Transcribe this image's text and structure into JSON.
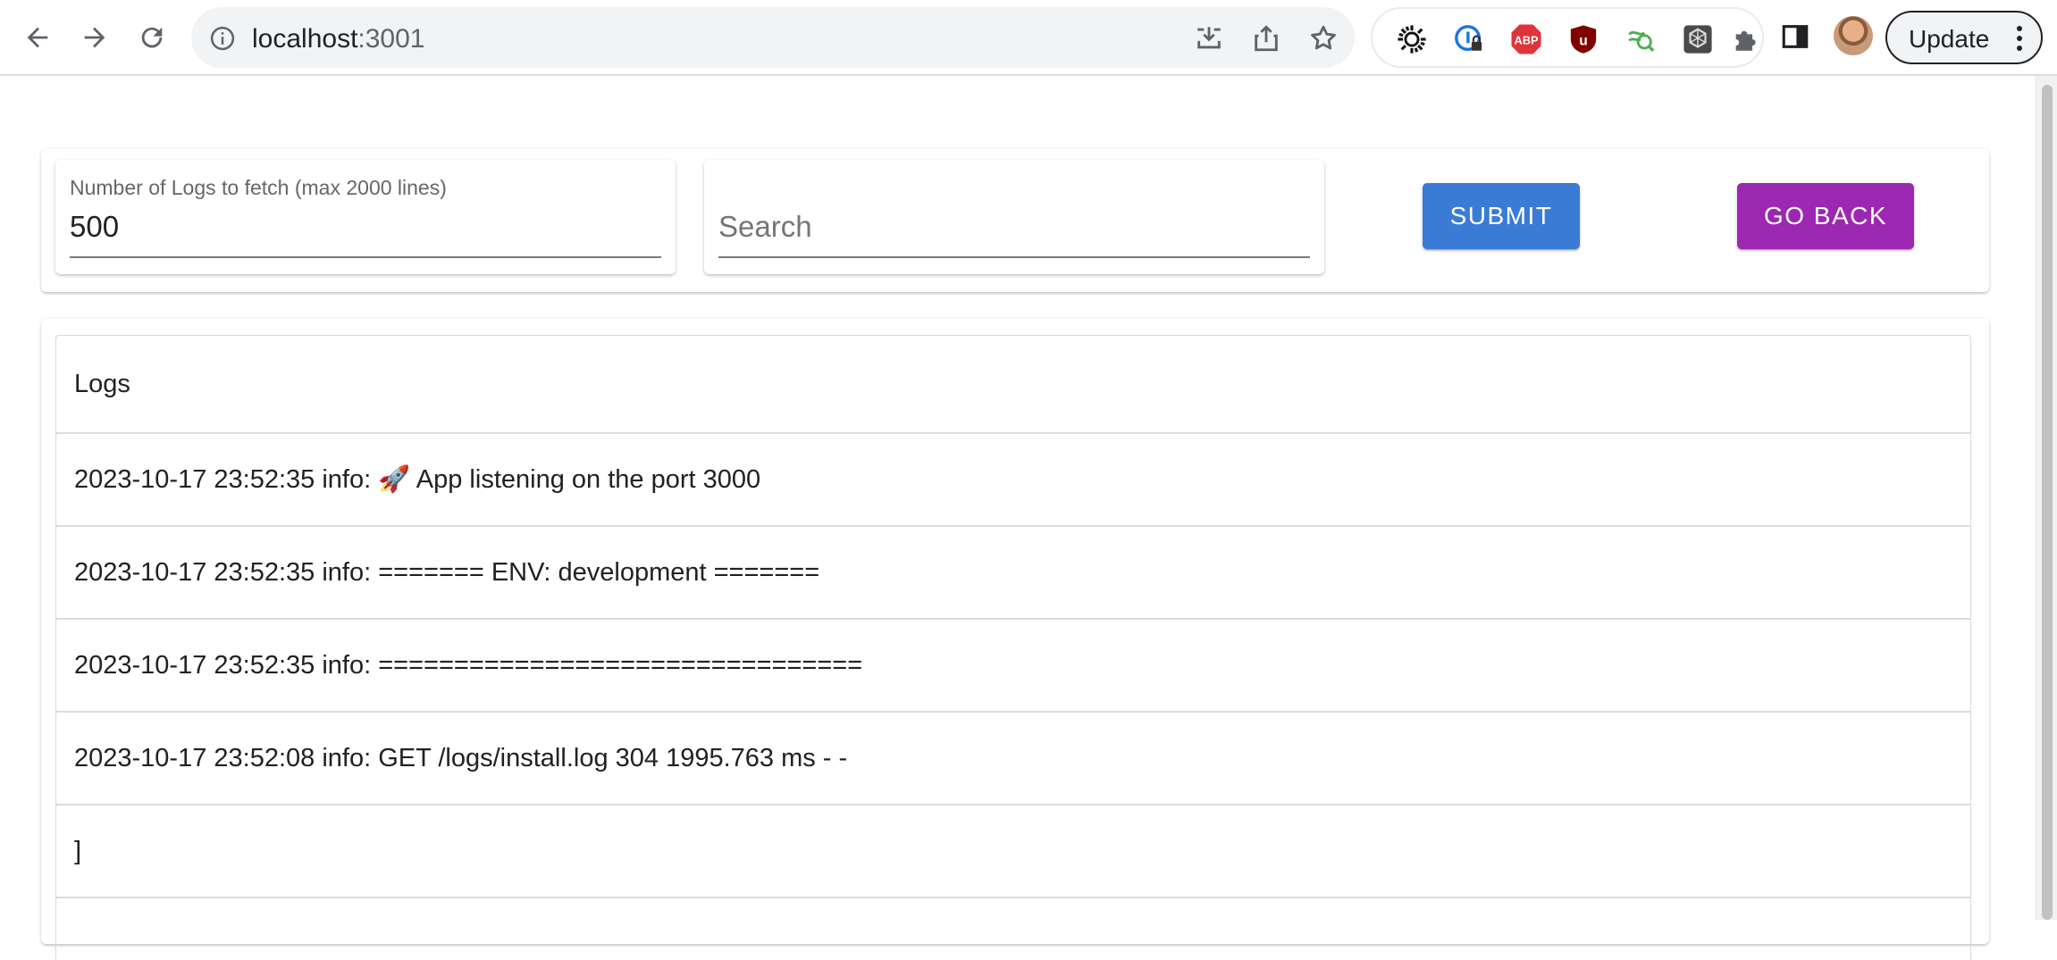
{
  "browser": {
    "url_host": "localhost",
    "url_port": ":3001",
    "update_label": "Update",
    "extensions": [
      "sun-extension-icon",
      "password-manager-icon",
      "adblock-plus-icon",
      "ublock-origin-icon",
      "search-extension-icon",
      "openai-extension-icon",
      "puzzle-piece-icon"
    ]
  },
  "controls": {
    "log_count_label": "Number of Logs to fetch (max 2000 lines)",
    "log_count_value": "500",
    "search_placeholder": "Search",
    "submit_label": "SUBMIT",
    "go_back_label": "GO BACK"
  },
  "logs": {
    "header": "Logs",
    "rows": [
      "2023-10-17 23:52:35 info: 🚀 App listening on the port 3000",
      "2023-10-17 23:52:35 info: ======= ENV: development =======",
      "2023-10-17 23:52:35 info: ================================",
      "2023-10-17 23:52:08 info: GET /logs/install.log 304 1995.763 ms - -",
      "]"
    ]
  },
  "colors": {
    "submit": "#3a7bd5",
    "go_back": "#9c27b0"
  }
}
